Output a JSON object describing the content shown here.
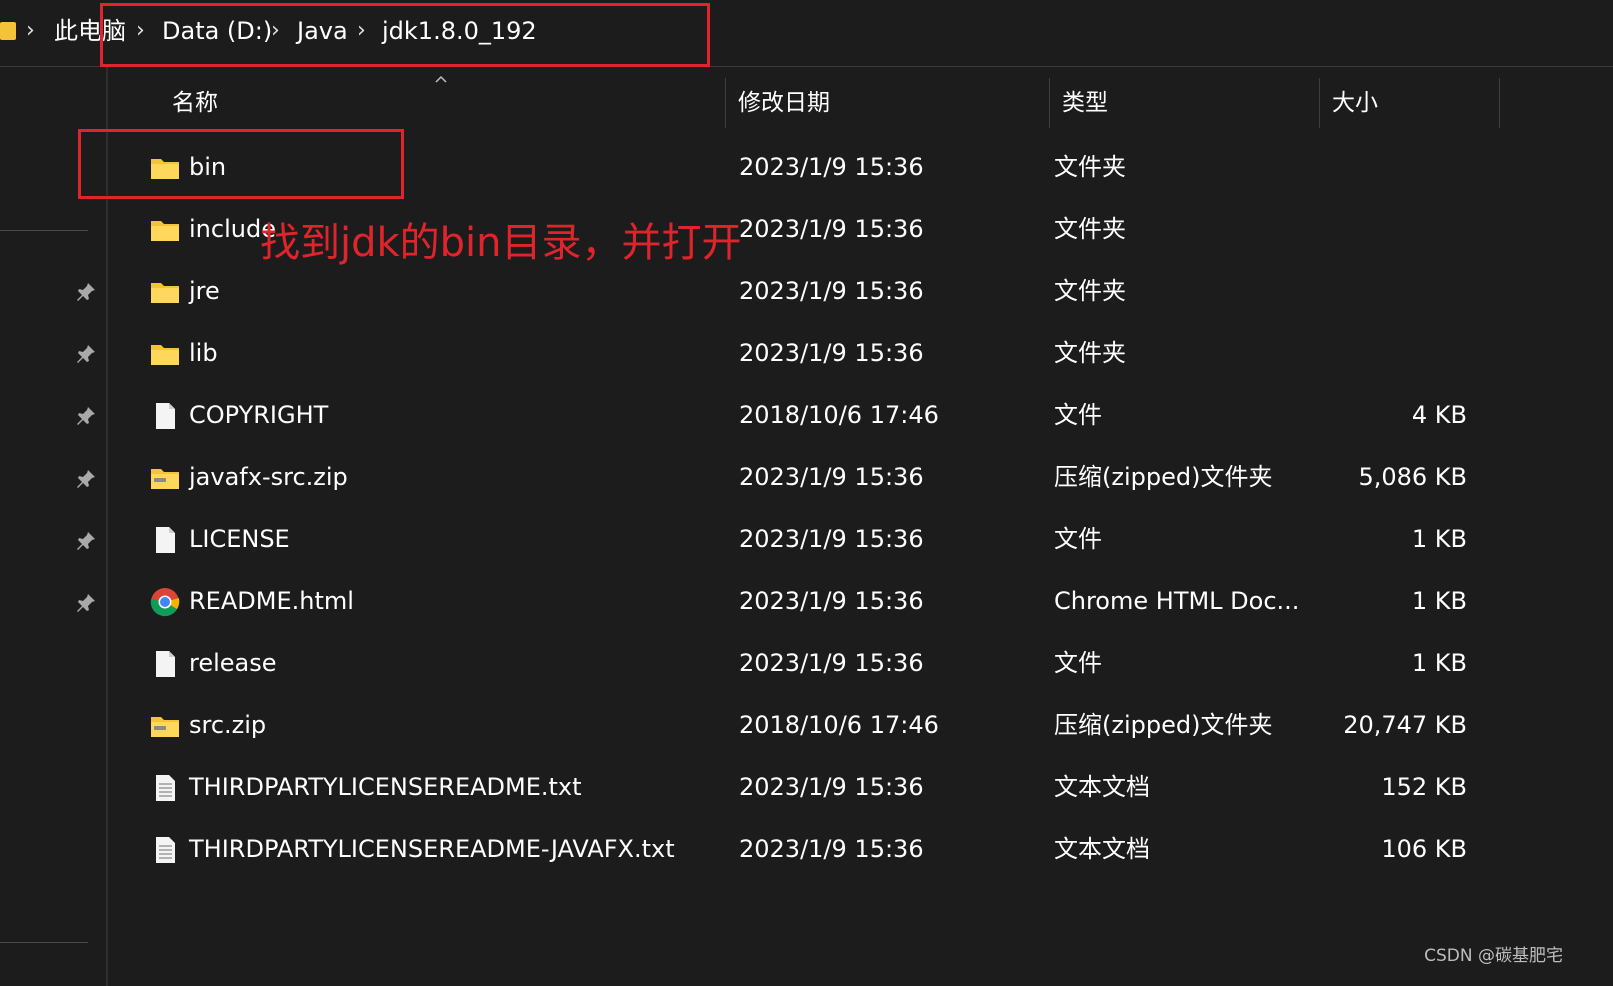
{
  "breadcrumb": {
    "items": [
      "此电脑",
      "Data (D:)",
      "Java",
      "jdk1.8.0_192"
    ]
  },
  "columns": {
    "name": "名称",
    "modified": "修改日期",
    "type": "类型",
    "size": "大小"
  },
  "files": [
    {
      "name": "bin",
      "modified": "2023/1/9 15:36",
      "type": "文件夹",
      "size": "",
      "icon": "folder-icon"
    },
    {
      "name": "include",
      "modified": "2023/1/9 15:36",
      "type": "文件夹",
      "size": "",
      "icon": "folder-icon"
    },
    {
      "name": "jre",
      "modified": "2023/1/9 15:36",
      "type": "文件夹",
      "size": "",
      "icon": "folder-icon"
    },
    {
      "name": "lib",
      "modified": "2023/1/9 15:36",
      "type": "文件夹",
      "size": "",
      "icon": "folder-icon"
    },
    {
      "name": "COPYRIGHT",
      "modified": "2018/10/6 17:46",
      "type": "文件",
      "size": "4 KB",
      "icon": "file-icon"
    },
    {
      "name": "javafx-src.zip",
      "modified": "2023/1/9 15:36",
      "type": "压缩(zipped)文件夹",
      "size": "5,086 KB",
      "icon": "zip-folder-icon"
    },
    {
      "name": "LICENSE",
      "modified": "2023/1/9 15:36",
      "type": "文件",
      "size": "1 KB",
      "icon": "file-icon"
    },
    {
      "name": "README.html",
      "modified": "2023/1/9 15:36",
      "type": "Chrome HTML Doc...",
      "size": "1 KB",
      "icon": "chrome-icon"
    },
    {
      "name": "release",
      "modified": "2023/1/9 15:36",
      "type": "文件",
      "size": "1 KB",
      "icon": "file-icon"
    },
    {
      "name": "src.zip",
      "modified": "2018/10/6 17:46",
      "type": "压缩(zipped)文件夹",
      "size": "20,747 KB",
      "icon": "zip-folder-icon"
    },
    {
      "name": "THIRDPARTYLICENSEREADME.txt",
      "modified": "2023/1/9 15:36",
      "type": "文本文档",
      "size": "152 KB",
      "icon": "text-file-icon"
    },
    {
      "name": "THIRDPARTYLICENSEREADME-JAVAFX.txt",
      "modified": "2023/1/9 15:36",
      "type": "文本文档",
      "size": "106 KB",
      "icon": "text-file-icon"
    }
  ],
  "annotation": {
    "text": "找到jdk的bin目录，并打开",
    "color": "#e0242c"
  },
  "watermark": "CSDN @碳基肥宅",
  "colors": {
    "background": "#1c1c1c",
    "folder": "#f3c33a",
    "highlight_box": "#e0242c"
  }
}
